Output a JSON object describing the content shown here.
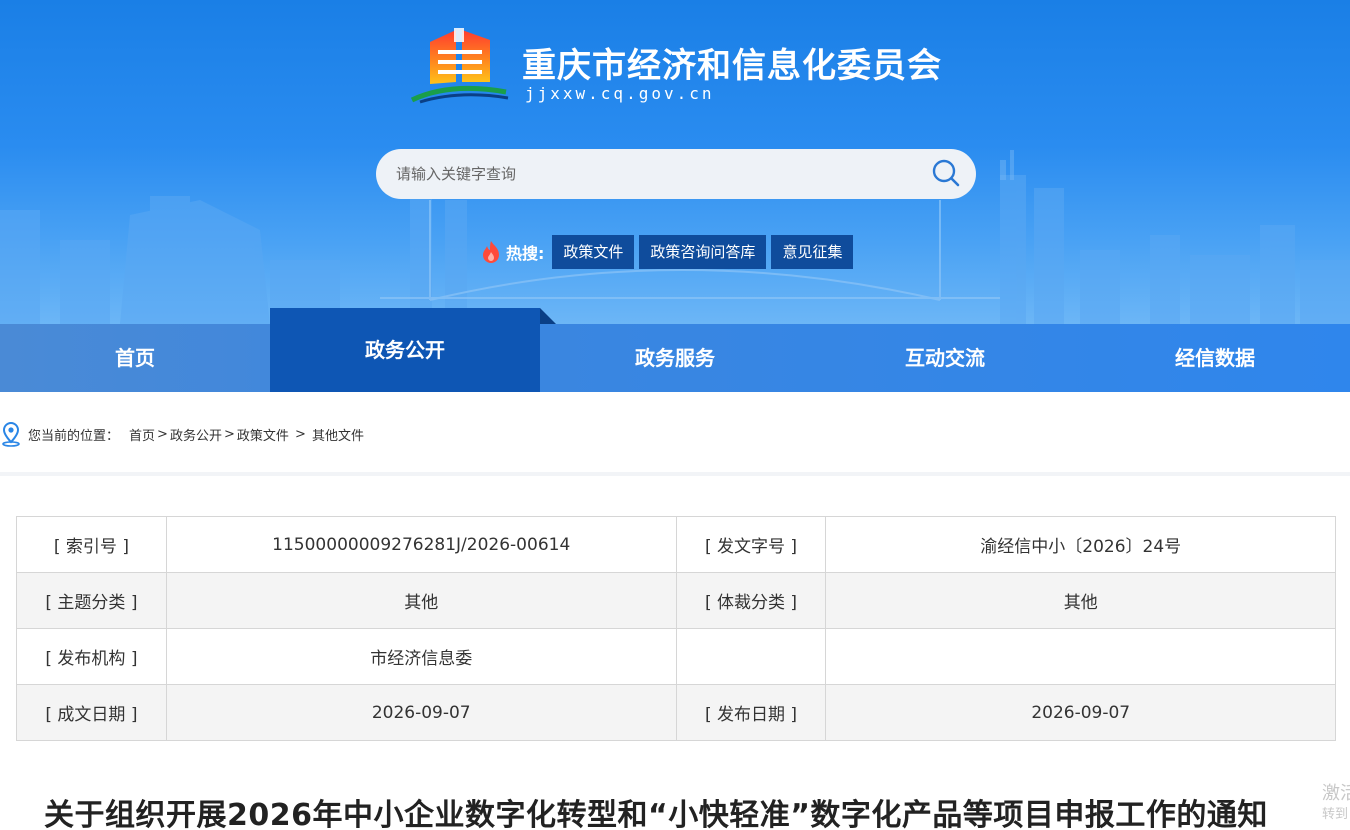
{
  "header": {
    "site_title": "重庆市经济和信息化委员会",
    "site_domain": "jjxxw.cq.gov.cn",
    "logo_icon": "city-hall-logo-icon",
    "colors": {
      "banner": "#1a7fe6",
      "nav": "#3a86e0",
      "nav_active": "#0e56b4",
      "hot_tag": "#0f4c9c"
    }
  },
  "search": {
    "placeholder": "请输入关键字查询",
    "value": "",
    "icon": "search-icon"
  },
  "hot_search": {
    "label": "热搜:",
    "icon": "fire-icon",
    "tags": [
      "政策文件",
      "政策咨询问答库",
      "意见征集"
    ]
  },
  "nav": {
    "items": [
      "首页",
      "政务公开",
      "政务服务",
      "互动交流",
      "经信数据"
    ],
    "active": "政务公开"
  },
  "breadcrumb": {
    "prefix": "您当前的位置：",
    "icon": "location-pin-icon",
    "items": [
      "首页",
      "政务公开",
      "政策文件",
      "其他文件"
    ],
    "separators": [
      ">",
      ">",
      " > "
    ]
  },
  "meta": {
    "rows": [
      {
        "l1": "[ 索引号 ]",
        "v1": "11500000009276281J/2026-00614",
        "l2": "[ 发文字号 ]",
        "v2": "渝经信中小〔2026〕24号"
      },
      {
        "l1": "[ 主题分类 ]",
        "v1": "其他",
        "l2": "[ 体裁分类 ]",
        "v2": "其他"
      },
      {
        "l1": "[ 发布机构 ]",
        "v1": "市经济信息委",
        "l2": "",
        "v2": ""
      },
      {
        "l1": "[ 成文日期 ]",
        "v1": "2026-09-07",
        "l2": "[ 发布日期 ]",
        "v2": "2026-09-07"
      }
    ]
  },
  "article": {
    "title": "关于组织开展2026年中小企业数字化转型和“小快轻准”数字化产品等项目申报工作的通知"
  },
  "watermark": {
    "line1": "激活",
    "line2": "转到"
  }
}
